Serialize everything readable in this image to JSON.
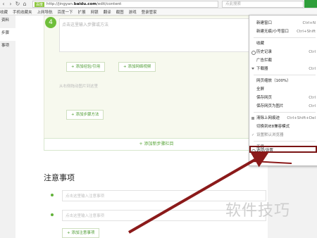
{
  "browser": {
    "secure_label": "百度",
    "url_prefix": "http://jingyan.",
    "url_domain": "baidu.com",
    "url_path": "/edit/content",
    "search_placeholder": "点此搜索"
  },
  "bookmarks": [
    "收藏",
    "手机收藏夹",
    "上网导航",
    "百度一下",
    "扩展",
    "网银",
    "翻译",
    "截图",
    "游戏",
    "登录管家"
  ],
  "leftnav": {
    "items": [
      "资料",
      "步骤",
      "事项"
    ]
  },
  "editor": {
    "step_number": "4",
    "step_placeholder": "点击这里输入步骤或方法",
    "add_image_label": "+ 添加经验/引用",
    "add_video_label": "+ 添加网络视频",
    "image_hint": "从右侧拖动图片到这里",
    "add_substep_label": "+ 添加步骤方法",
    "add_step_section_label": "+ 添加新步骤栏目"
  },
  "notes": {
    "title": "注意事项",
    "placeholders": [
      "点击这里输入注意事项",
      "点击这里输入注意事项"
    ],
    "add_label": "+ 添加注意事项"
  },
  "context_menu": {
    "items": [
      {
        "label": "新建窗口",
        "shortcut": "Ctrl+N"
      },
      {
        "label": "新建无痕/小号窗口",
        "shortcut": "Ctrl+Shift"
      },
      {
        "label": "收藏",
        "shortcut": ""
      },
      {
        "label": "历史记录",
        "shortcut": "Ctrl"
      },
      {
        "label": "广告拦截",
        "shortcut": ""
      },
      {
        "label": "下载器",
        "shortcut": "Ctrl"
      },
      {
        "label": "网页缩放（100%）",
        "shortcut": ""
      },
      {
        "label": "全屏",
        "shortcut": ""
      },
      {
        "label": "保存网页",
        "shortcut": "Ctrl"
      },
      {
        "label": "保存网页为图片",
        "shortcut": "Ctrl"
      },
      {
        "label": "清除上网痕迹",
        "shortcut": "Ctrl+Shift+Del"
      },
      {
        "label": "切换到IE8兼容模式",
        "shortcut": ""
      },
      {
        "label": "设置默认浏览器",
        "shortcut": ""
      },
      {
        "label": "工具",
        "shortcut": ""
      },
      {
        "label": "选项/设置",
        "shortcut": ""
      },
      {
        "label": "帮助",
        "shortcut": ""
      }
    ],
    "highlighted_index": 14
  },
  "watermark": "软件技巧",
  "colors": {
    "accent_green": "#62b33a",
    "arrow": "#8b1a1a"
  }
}
